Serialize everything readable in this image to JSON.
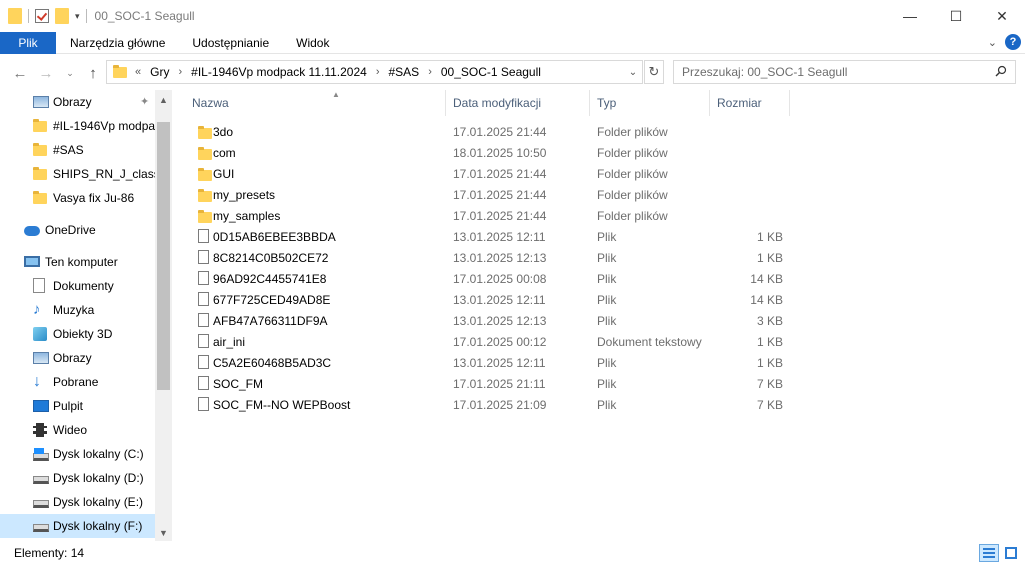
{
  "window": {
    "title": "00_SOC-1 Seagull",
    "controls": {
      "minimize": "—",
      "maximize": "☐",
      "close": "✕"
    }
  },
  "ribbon": {
    "file_tab": "Plik",
    "tabs": [
      "Narzędzia główne",
      "Udostępnianie",
      "Widok"
    ]
  },
  "address": {
    "overflow": "«",
    "crumbs": [
      "Gry",
      "#IL-1946Vp modpack 11.11.2024",
      "#SAS",
      "00_SOC-1 Seagull"
    ]
  },
  "search": {
    "placeholder": "Przeszukaj: 00_SOC-1 Seagull"
  },
  "sidebar": {
    "items": [
      {
        "label": "Obrazy",
        "icon": "pictures-icon",
        "pinned": true
      },
      {
        "label": "#IL-1946Vp modpa",
        "icon": "folder-icon"
      },
      {
        "label": "#SAS",
        "icon": "folder-icon"
      },
      {
        "label": "SHIPS_RN_J_class_d",
        "icon": "folder-icon"
      },
      {
        "label": "Vasya fix Ju-86",
        "icon": "folder-icon"
      },
      {
        "label": "OneDrive",
        "icon": "onedrive-icon"
      },
      {
        "label": "Ten komputer",
        "icon": "computer-icon"
      },
      {
        "label": "Dokumenty",
        "icon": "documents-icon"
      },
      {
        "label": "Muzyka",
        "icon": "music-icon"
      },
      {
        "label": "Obiekty 3D",
        "icon": "3d-objects-icon"
      },
      {
        "label": "Obrazy",
        "icon": "pictures-icon"
      },
      {
        "label": "Pobrane",
        "icon": "downloads-icon"
      },
      {
        "label": "Pulpit",
        "icon": "desktop-icon"
      },
      {
        "label": "Wideo",
        "icon": "video-icon"
      },
      {
        "label": "Dysk lokalny (C:)",
        "icon": "drive-icon"
      },
      {
        "label": "Dysk lokalny (D:)",
        "icon": "drive-icon"
      },
      {
        "label": "Dysk lokalny (E:)",
        "icon": "drive-icon"
      },
      {
        "label": "Dysk lokalny (F:)",
        "icon": "drive-icon"
      }
    ]
  },
  "columns": [
    "Nazwa",
    "Data modyfikacji",
    "Typ",
    "Rozmiar"
  ],
  "files": [
    {
      "name": "3do",
      "date": "17.01.2025 21:44",
      "type": "Folder plików",
      "size": "",
      "kind": "folder"
    },
    {
      "name": "com",
      "date": "18.01.2025 10:50",
      "type": "Folder plików",
      "size": "",
      "kind": "folder"
    },
    {
      "name": "GUI",
      "date": "17.01.2025 21:44",
      "type": "Folder plików",
      "size": "",
      "kind": "folder"
    },
    {
      "name": "my_presets",
      "date": "17.01.2025 21:44",
      "type": "Folder plików",
      "size": "",
      "kind": "folder"
    },
    {
      "name": "my_samples",
      "date": "17.01.2025 21:44",
      "type": "Folder plików",
      "size": "",
      "kind": "folder"
    },
    {
      "name": "0D15AB6EBEE3BBDA",
      "date": "13.01.2025 12:11",
      "type": "Plik",
      "size": "1 KB",
      "kind": "file"
    },
    {
      "name": "8C8214C0B502CE72",
      "date": "13.01.2025 12:13",
      "type": "Plik",
      "size": "1 KB",
      "kind": "file"
    },
    {
      "name": "96AD92C4455741E8",
      "date": "17.01.2025 00:08",
      "type": "Plik",
      "size": "14 KB",
      "kind": "file"
    },
    {
      "name": "677F725CED49AD8E",
      "date": "13.01.2025 12:11",
      "type": "Plik",
      "size": "14 KB",
      "kind": "file"
    },
    {
      "name": "AFB47A766311DF9A",
      "date": "13.01.2025 12:13",
      "type": "Plik",
      "size": "3 KB",
      "kind": "file"
    },
    {
      "name": "air_ini",
      "date": "17.01.2025 00:12",
      "type": "Dokument tekstowy",
      "size": "1 KB",
      "kind": "file"
    },
    {
      "name": "C5A2E60468B5AD3C",
      "date": "13.01.2025 12:11",
      "type": "Plik",
      "size": "1 KB",
      "kind": "file"
    },
    {
      "name": "SOC_FM",
      "date": "17.01.2025 21:11",
      "type": "Plik",
      "size": "7 KB",
      "kind": "file"
    },
    {
      "name": "SOC_FM--NO WEPBoost",
      "date": "17.01.2025 21:09",
      "type": "Plik",
      "size": "7 KB",
      "kind": "file"
    }
  ],
  "status": {
    "count": "Elementy: 14"
  }
}
